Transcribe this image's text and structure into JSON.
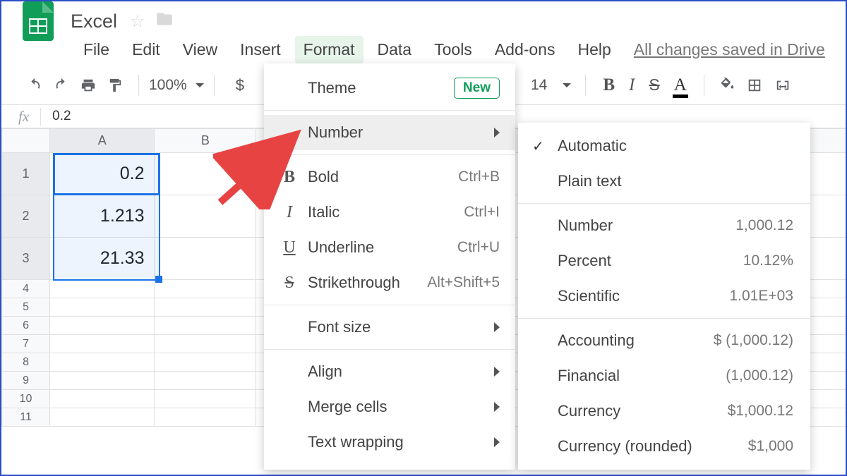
{
  "doc": {
    "title": "Excel"
  },
  "menu": {
    "file": "File",
    "edit": "Edit",
    "view": "View",
    "insert": "Insert",
    "format": "Format",
    "data": "Data",
    "tools": "Tools",
    "addons": "Add-ons",
    "help": "Help",
    "saved": "All changes saved in Drive"
  },
  "toolbar": {
    "zoom": "100%",
    "font_size": "14"
  },
  "fx": {
    "label": "fx",
    "value": "0.2"
  },
  "columns": [
    "A",
    "B"
  ],
  "rows": [
    "1",
    "2",
    "3",
    "4",
    "5",
    "6",
    "7",
    "8",
    "9",
    "10",
    "11"
  ],
  "cells": {
    "A1": "0.2",
    "A2": "1.213",
    "A3": "21.33"
  },
  "format_menu": {
    "theme": "Theme",
    "theme_badge": "New",
    "number": "Number",
    "bold": "Bold",
    "bold_sc": "Ctrl+B",
    "italic": "Italic",
    "italic_sc": "Ctrl+I",
    "underline": "Underline",
    "underline_sc": "Ctrl+U",
    "strike": "Strikethrough",
    "strike_sc": "Alt+Shift+5",
    "fontsize": "Font size",
    "align": "Align",
    "merge": "Merge cells",
    "wrap": "Text wrapping"
  },
  "number_menu": {
    "automatic": "Automatic",
    "plain": "Plain text",
    "number": "Number",
    "number_ex": "1,000.12",
    "percent": "Percent",
    "percent_ex": "10.12%",
    "scientific": "Scientific",
    "scientific_ex": "1.01E+03",
    "accounting": "Accounting",
    "accounting_ex": "$ (1,000.12)",
    "financial": "Financial",
    "financial_ex": "(1,000.12)",
    "currency": "Currency",
    "currency_ex": "$1,000.12",
    "currency_r": "Currency (rounded)",
    "currency_r_ex": "$1,000"
  }
}
